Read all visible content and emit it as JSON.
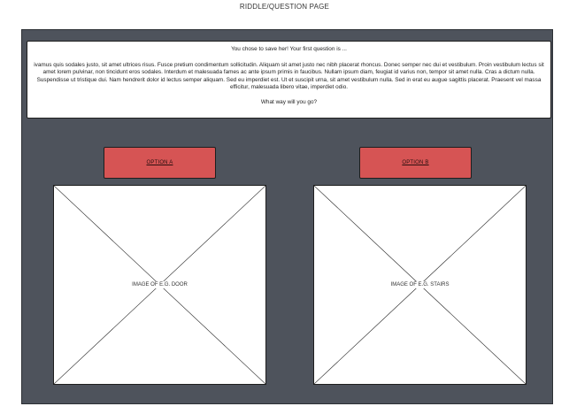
{
  "page": {
    "title": "RIDDLE/QUESTION PAGE"
  },
  "question_panel": {
    "intro": "You chose to save her!  Your first question is ...",
    "body": "ivamus quis sodales justo, sit amet ultrices risus. Fusce pretium condimentum sollicitudin. Aliquam sit amet justo nec nibh placerat rhoncus. Donec semper nec dui et vestibulum. Proin vestibulum lectus sit amet lorem pulvinar, non tincidunt eros sodales. Interdum et malesuada fames ac ante ipsum primis in faucibus. Nullam ipsum diam, feugiat id varius non, tempor sit amet nulla. Cras a dictum nulla. Suspendisse ut tristique dui. Nam hendrerit dolor id lectus semper aliquam. Sed eu imperdiet est. Ut et suscipit urna, sit amet vestibulum nulla. Sed in erat eu augue sagittis placerat. Praesent vel massa efficitur, malesuada libero vitae, imperdiet odio.",
    "prompt": "What way will you go?"
  },
  "options": [
    {
      "label": "OPTION A",
      "image_caption": "IMAGE OF E.G. DOOR"
    },
    {
      "label": "OPTION B",
      "image_caption": "IMAGE OF E.G. STAIRS"
    }
  ],
  "colors": {
    "frame_background": "#4e535c",
    "button_red": "#d65454",
    "panel_background": "#ffffff"
  }
}
